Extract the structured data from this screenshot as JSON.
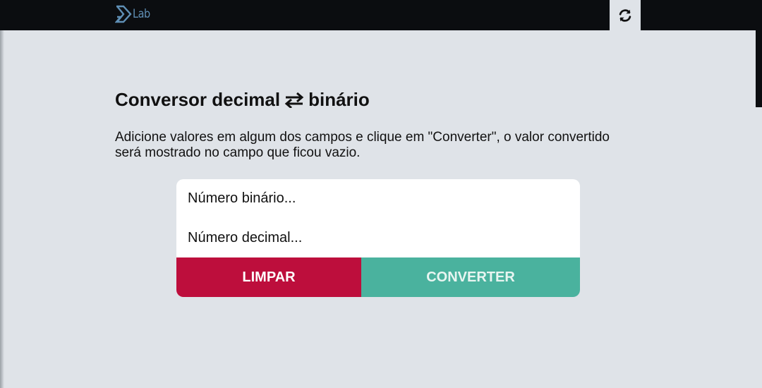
{
  "header": {
    "logo_text": "Lab",
    "refresh_icon": "refresh-icon"
  },
  "main": {
    "title_left": "Conversor decimal",
    "title_icon": "swap-arrows-icon",
    "title_right": "binário",
    "description": "Adicione valores em algum dos campos e clique em \"Converter\", o valor convertido será mostrado no campo que ficou vazio."
  },
  "form": {
    "binary_placeholder": "Número binário...",
    "decimal_placeholder": "Número decimal...",
    "clear_label": "LIMPAR",
    "convert_label": "CONVERTER"
  },
  "colors": {
    "topbar": "#0b0d10",
    "background": "#dfe3e8",
    "clear_button": "#bd0e3c",
    "convert_button": "#4ab29e",
    "logo": "#5f8fb5"
  }
}
